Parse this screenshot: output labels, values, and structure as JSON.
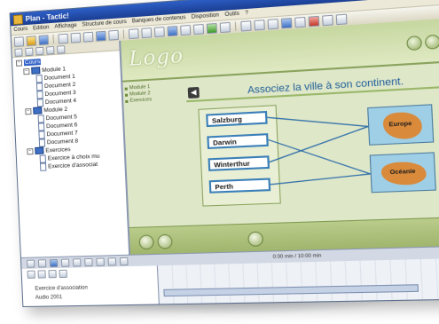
{
  "window": {
    "title": "Plan - Tactic!"
  },
  "menu": [
    "Cours",
    "Edition",
    "Affichage",
    "Structure de cours",
    "Banques de contenus",
    "Disposition",
    "Outils",
    "?"
  ],
  "tree": {
    "root": "Cours",
    "module1": "Module 1",
    "m1_docs": [
      "Document 1",
      "Document 2",
      "Document 3",
      "Document 4"
    ],
    "module2": "Module 2",
    "m2_docs": [
      "Document 5",
      "Document 6",
      "Document 7",
      "Document 8"
    ],
    "exercises": "Exercices",
    "ex_items": [
      "Exercice à choix mu",
      "Exercice d'associat"
    ]
  },
  "stage": {
    "logo": "Logo",
    "nav": [
      "Module 1",
      "Module 2",
      "Exercices"
    ],
    "question": "Associez la ville à son continent.",
    "cities": [
      "Salzburg",
      "Darwin",
      "Winterthur",
      "Perth"
    ],
    "continents": [
      "Europe",
      "Océanie"
    ]
  },
  "controls": {
    "time": "0:00 min / 10:00 min"
  },
  "timeline": {
    "item1": "Exercice d'association",
    "item2": "Audio 2001"
  },
  "colors": {
    "titlebar": "#2d5fc7",
    "stage_bg": "#dfe7c9",
    "accent": "#3a7fb8",
    "question": "#1f5e98"
  }
}
